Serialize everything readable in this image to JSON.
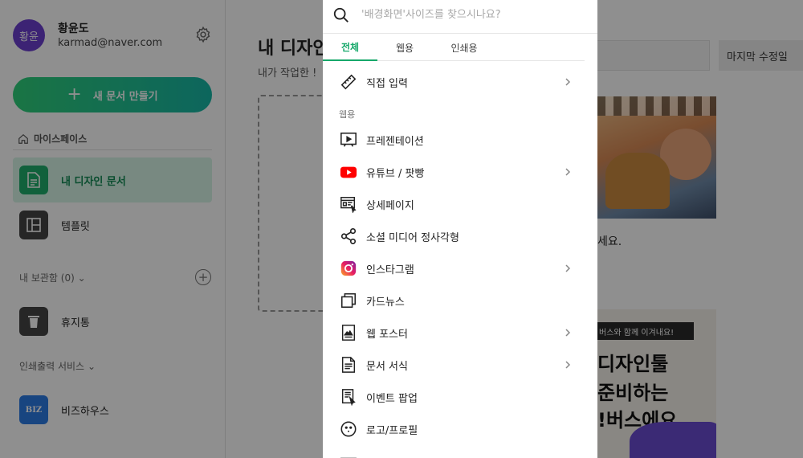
{
  "user": {
    "avatar_text": "황윤",
    "name": "황윤도",
    "email": "karmad@naver.com"
  },
  "sidebar": {
    "new_doc_label": "새 문서 만들기",
    "workspace_label": "마이스페이스",
    "items": [
      {
        "label": "내 디자인 문서",
        "active": true
      },
      {
        "label": "템플릿",
        "active": false
      }
    ],
    "storage_label": "내 보관함 (0)",
    "trash_label": "휴지통",
    "print_service_label": "인쇄출력 서비스",
    "biz_label": "비즈하우스",
    "biz_icon_text": "BIZ"
  },
  "main": {
    "title": "내 디자인",
    "subtitle": "내가 작업한 !",
    "sort_label": "마지막 수정일",
    "card1_caption": "세요.",
    "card2_banner": "버스와 함께 이겨내요!",
    "card2_line1": "디자인툴",
    "card2_line2": "준비하는",
    "card2_line3": "!버스에요"
  },
  "size_menu": {
    "search_placeholder": "'배경화면'사이즈를 찾으시나요?",
    "search_value": "",
    "tabs": [
      {
        "label": "전체",
        "active": true
      },
      {
        "label": "웹용",
        "active": false
      },
      {
        "label": "인쇄용",
        "active": false
      }
    ],
    "direct_input": {
      "label": "직접 입력",
      "icon": "ruler-icon",
      "has_submenu": true
    },
    "web_group_label": "웹용",
    "items": [
      {
        "label": "프레젠테이션",
        "icon": "presentation-icon",
        "has_submenu": false
      },
      {
        "label": "유튜브 / 팟빵",
        "icon": "youtube-icon",
        "has_submenu": true
      },
      {
        "label": "상세페이지",
        "icon": "detail-page-icon",
        "has_submenu": false
      },
      {
        "label": "소셜 미디어 정사각형",
        "icon": "share-icon",
        "has_submenu": false
      },
      {
        "label": "인스타그램",
        "icon": "instagram-icon",
        "has_submenu": true
      },
      {
        "label": "카드뉴스",
        "icon": "card-news-icon",
        "has_submenu": false
      },
      {
        "label": "웹 포스터",
        "icon": "poster-icon",
        "has_submenu": true
      },
      {
        "label": "문서 서식",
        "icon": "document-icon",
        "has_submenu": true
      },
      {
        "label": "이벤트 팝업",
        "icon": "event-popup-icon",
        "has_submenu": false
      },
      {
        "label": "로고/프로필",
        "icon": "logo-profile-icon",
        "has_submenu": false
      }
    ]
  },
  "colors": {
    "accent_green": "#16a86a",
    "active_bg": "#d6f5e6",
    "avatar_purple": "#6b3fcf",
    "youtube_red": "#ff0000",
    "overlay": "rgba(0,0,0,0.44)"
  }
}
